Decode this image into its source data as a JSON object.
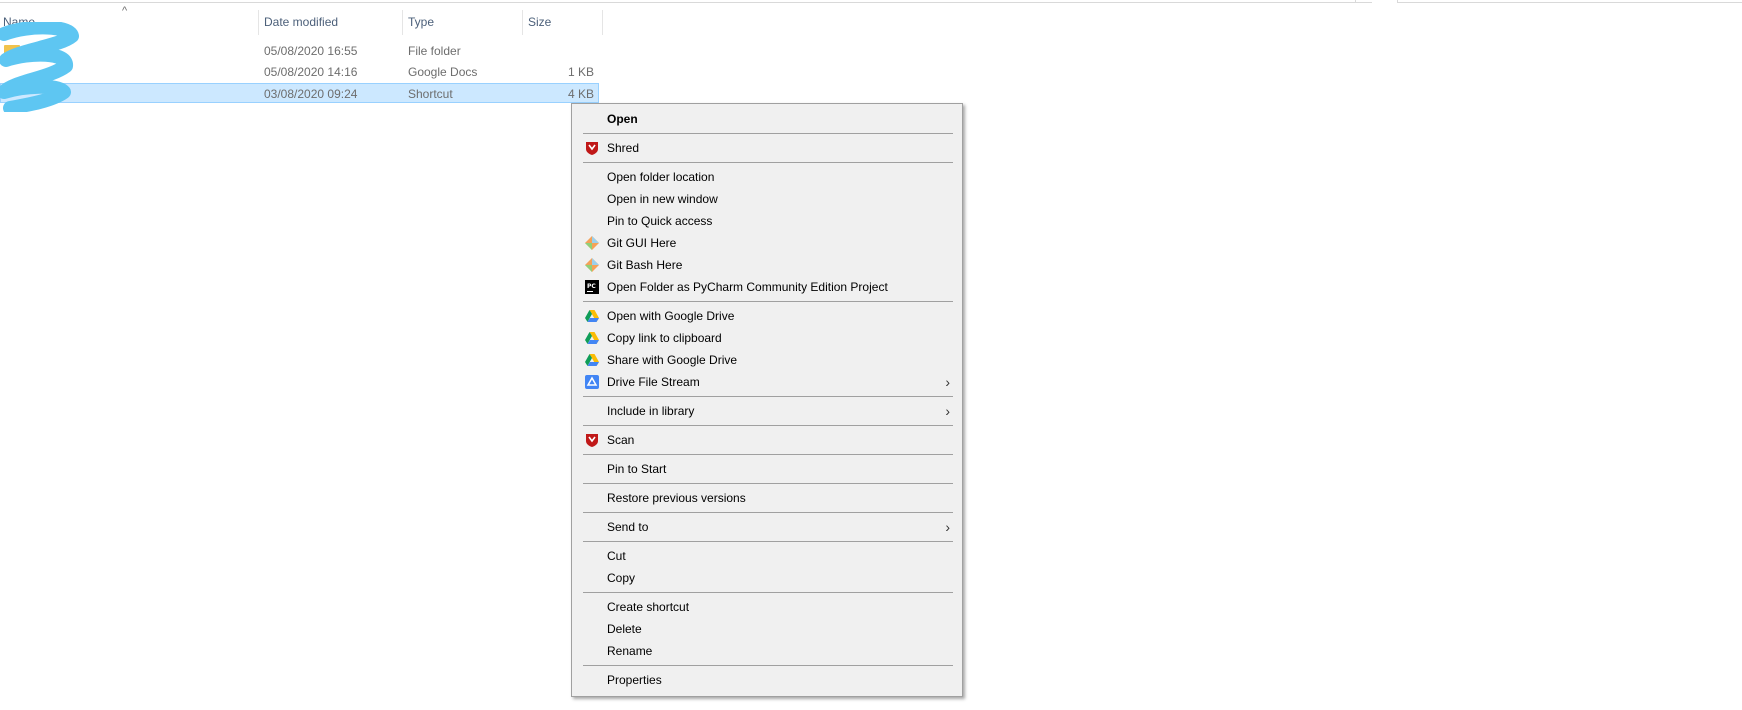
{
  "columns": {
    "name": "Name",
    "date_modified": "Date modified",
    "type": "Type",
    "size": "Size"
  },
  "rows": [
    {
      "name": "",
      "date": "05/08/2020 16:55",
      "type": "File folder",
      "size": "",
      "selected": false
    },
    {
      "name": "s",
      "date": "05/08/2020 14:16",
      "type": "Google Docs",
      "size": "1 KB",
      "selected": false
    },
    {
      "name": "",
      "date": "03/08/2020 09:24",
      "type": "Shortcut",
      "size": "4 KB",
      "selected": true
    }
  ],
  "context_menu": {
    "items": {
      "open": "Open",
      "shred": "Shred",
      "open_folder_location": "Open folder location",
      "open_in_new_window": "Open in new window",
      "pin_quick_access": "Pin to Quick access",
      "git_gui": "Git GUI Here",
      "git_bash": "Git Bash Here",
      "pycharm": "Open Folder as PyCharm Community Edition Project",
      "open_google_drive": "Open with Google Drive",
      "copy_link": "Copy link to clipboard",
      "share_google_drive": "Share with Google Drive",
      "drive_file_stream": "Drive File Stream",
      "include_in_library": "Include in library",
      "scan": "Scan",
      "pin_to_start": "Pin to Start",
      "restore_previous": "Restore previous versions",
      "send_to": "Send to",
      "cut": "Cut",
      "copy": "Copy",
      "create_shortcut": "Create shortcut",
      "delete": "Delete",
      "rename": "Rename",
      "properties": "Properties"
    },
    "icons": {
      "mcafee": "mcafee-shield-icon",
      "git": "git-diamond-icon",
      "pycharm": "pycharm-icon",
      "google_drive": "google-drive-icon",
      "drive_file_stream": "drive-file-stream-icon",
      "submenu": "chevron-right-icon"
    }
  },
  "colors": {
    "selection": "#cce8ff",
    "selection_border": "#99d1ff",
    "menu_bg": "#f0f0f0",
    "header_text": "#4c607a",
    "scribble": "#5ec6f2",
    "mcafee_red": "#c01818"
  }
}
